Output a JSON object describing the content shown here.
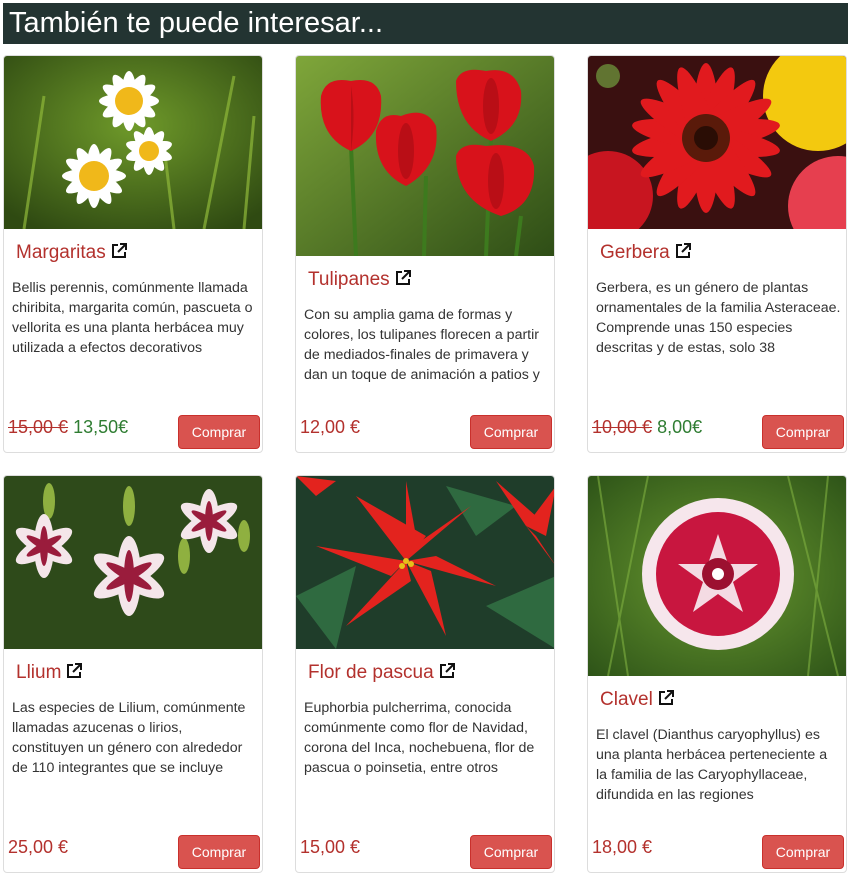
{
  "section_title": "También te puede interesar...",
  "buy_label": "Comprar",
  "colors": {
    "header_bg": "#233432",
    "title_red": "#b3312d",
    "sale_green": "#2f7d32",
    "button_red": "#d9534f"
  },
  "products": [
    {
      "name": "Margaritas",
      "description": "Bellis perennis, comúnmente llamada chiribita, margarita común, pascueta o vellorita es una planta herbácea muy utilizada a efectos decorativos",
      "old_price": "15,00 €",
      "price": "13,50€",
      "icon": "external-link-icon"
    },
    {
      "name": "Tulipanes",
      "description": "Con su amplia gama de formas y colores, los tulipanes florecen a partir de mediados-finales de primavera y dan un toque de animación a patios y",
      "old_price": "",
      "price": "12,00 €",
      "icon": "external-link-icon"
    },
    {
      "name": "Gerbera",
      "description": "Gerbera, es un género de plantas ornamentales de la familia Asteraceae. Comprende unas 150 especies descritas y de estas, solo 38",
      "old_price": "10,00 €",
      "price": "8,00€",
      "icon": "external-link-icon"
    },
    {
      "name": "Llium",
      "description": "Las especies de Lilium, comúnmente llamadas azucenas o lirios, constituyen un género con alrededor de 110 integrantes que se incluye",
      "old_price": "",
      "price": "25,00 €",
      "icon": "external-link-icon"
    },
    {
      "name": "Flor de pascua",
      "description": "Euphorbia pulcherrima, conocida comúnmente como flor de Navidad, corona del Inca, nochebuena, flor de pascua o poinsetia, entre otros",
      "old_price": "",
      "price": "15,00 €",
      "icon": "external-link-icon"
    },
    {
      "name": "Clavel",
      "description": "El clavel (Dianthus caryophyllus) es una planta herbácea perteneciente a la familia de las Caryophyllaceae, difundida en las regiones",
      "old_price": "",
      "price": "18,00 €",
      "icon": "external-link-icon"
    }
  ]
}
